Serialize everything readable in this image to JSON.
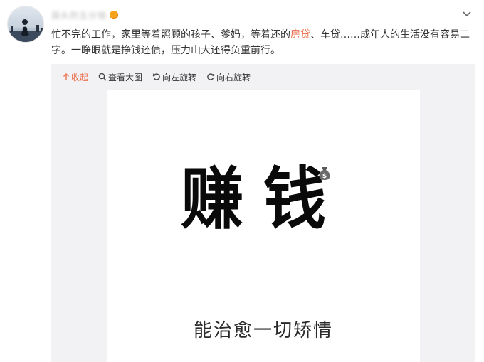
{
  "user": {
    "name": "蒜头的五分钱",
    "badge_icon": "vip-crown-icon"
  },
  "menu_icon": "chevron-down-icon",
  "post": {
    "text_before": "忙不完的工作，家里等着照顾的孩子、爹妈，等着还的",
    "keyword": "房贷",
    "text_after": "、车贷……成年人的生活没有容易二字。一睁眼就是挣钱还债，压力山大还得负重前行。",
    "keyword_color": "#eb7350"
  },
  "toolbar": {
    "collapse": "收起",
    "view_large": "查看大图",
    "rotate_left": "向左旋转",
    "rotate_right": "向右旋转"
  },
  "image": {
    "title": "赚钱",
    "subtitle": "能治愈一切矫情"
  }
}
